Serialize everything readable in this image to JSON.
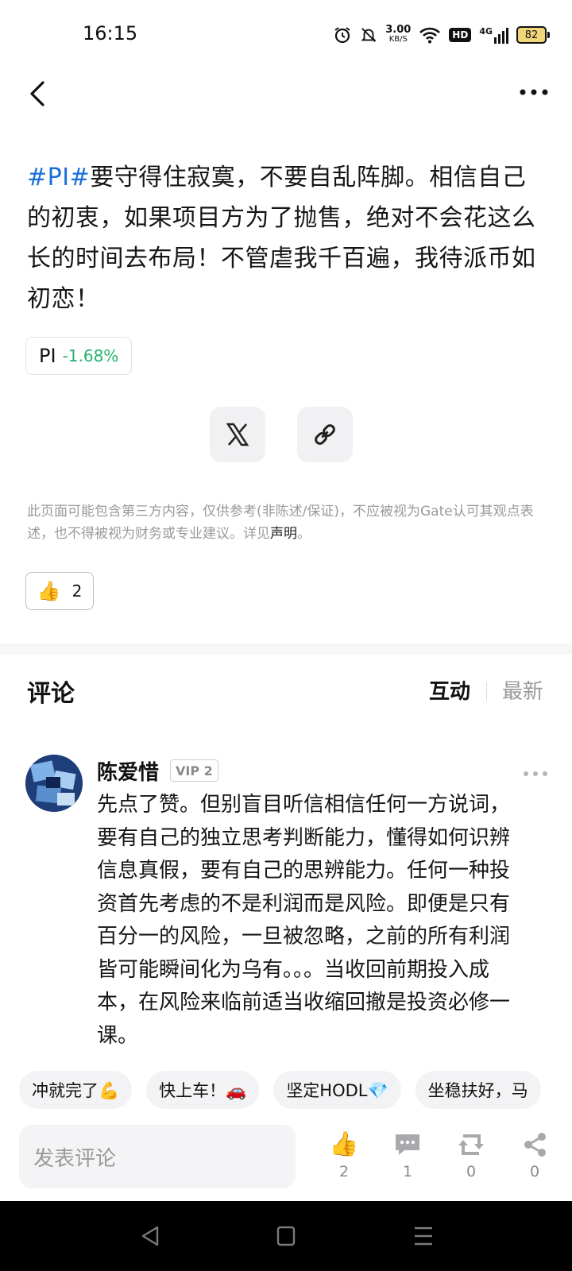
{
  "status_bar": {
    "time": "16:15",
    "net_speed_value": "3.00",
    "net_speed_unit": "KB/S",
    "hd_label": "HD",
    "network_label": "4G",
    "battery_level": "82"
  },
  "post": {
    "hashtag": "#PI#",
    "text": "要守得住寂寞，不要自乱阵脚。相信自己的初衷，如果项目方为了抛售，绝对不会花这么长的时间去布局！不管虐我千百遍，我待派币如初恋！",
    "ticker": {
      "name": "PI",
      "change": "-1.68%"
    }
  },
  "disclaimer": {
    "text": "此页面可能包含第三方内容，仅供参考(非陈述/保证)，不应被视为Gate认可其观点表述，也不得被视为财务或专业建议。详见",
    "link": "声明",
    "end": "。"
  },
  "post_like_count": "2",
  "comments": {
    "title": "评论",
    "sort_hot": "互动",
    "sort_new": "最新",
    "items": [
      {
        "user": "陈爱惜",
        "badge": "VIP 2",
        "text": "先点了赞。但别盲目听信相信任何一方说词，要有自己的独立思考判断能力，懂得如何识辨信息真假，要有自己的思辨能力。任何一种投资首先考虑的不是利润而是风险。即便是只有百分一的风险，一旦被忽略，之前的所有利润皆可能瞬间化为乌有。。。当收回前期投入成本，在风险来临前适当收缩回撤是投资必修一课。"
      }
    ]
  },
  "quick_replies": [
    "冲就完了💪",
    "快上车！🚗",
    "坚定HODL💎",
    "坐稳扶好，马"
  ],
  "bottom_bar": {
    "input_placeholder": "发表评论",
    "like_count": "2",
    "comment_count": "1",
    "repost_count": "0",
    "share_count": "0"
  }
}
